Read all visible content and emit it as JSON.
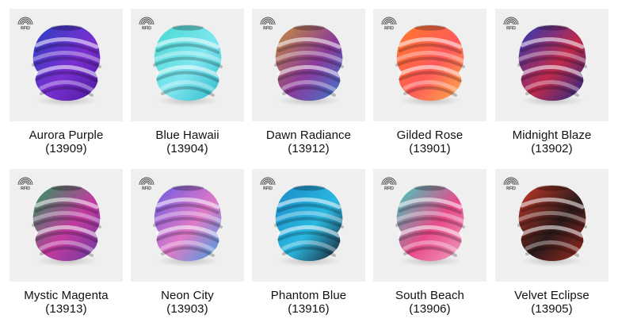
{
  "products": [
    {
      "name": "Aurora Purple",
      "code": "(13909)",
      "icon": "rfid-icon",
      "colors": [
        "#2a3fc4",
        "#7a2fd0",
        "#4b1a9e"
      ]
    },
    {
      "name": "Blue Hawaii",
      "code": "(13904)",
      "icon": "rfid-icon",
      "colors": [
        "#46d8d0",
        "#7fe6f0",
        "#2ab8c8"
      ]
    },
    {
      "name": "Dawn Radiance",
      "code": "(13912)",
      "icon": "rfid-icon",
      "colors": [
        "#c8923a",
        "#8a3a9a",
        "#3a7ad0"
      ]
    },
    {
      "name": "Gilded Rose",
      "code": "(13901)",
      "icon": "rfid-icon",
      "colors": [
        "#ff7a2a",
        "#ff5a5a",
        "#ffb04a"
      ]
    },
    {
      "name": "Midnight Blaze",
      "code": "(13902)",
      "icon": "rfid-icon",
      "colors": [
        "#2a3ab8",
        "#c02a4a",
        "#1a2a8a"
      ]
    },
    {
      "name": "Mystic Magenta",
      "code": "(13913)",
      "icon": "rfid-icon",
      "colors": [
        "#2a9a5a",
        "#c23aa0",
        "#6a3aa0"
      ]
    },
    {
      "name": "Neon City",
      "code": "(13903)",
      "icon": "rfid-icon",
      "colors": [
        "#6a5ae0",
        "#e07ac8",
        "#3aa0e0"
      ]
    },
    {
      "name": "Phantom Blue",
      "code": "(13916)",
      "icon": "rfid-icon",
      "colors": [
        "#1a8ac8",
        "#2ab8e0",
        "#1a1a2a"
      ]
    },
    {
      "name": "South Beach",
      "code": "(13906)",
      "icon": "rfid-icon",
      "colors": [
        "#3ad0c0",
        "#e84a8a",
        "#f0a0c0"
      ]
    },
    {
      "name": "Velvet Eclipse",
      "code": "(13905)",
      "icon": "rfid-icon",
      "colors": [
        "#c83a2a",
        "#2a1a1a",
        "#a02a20"
      ]
    }
  ]
}
